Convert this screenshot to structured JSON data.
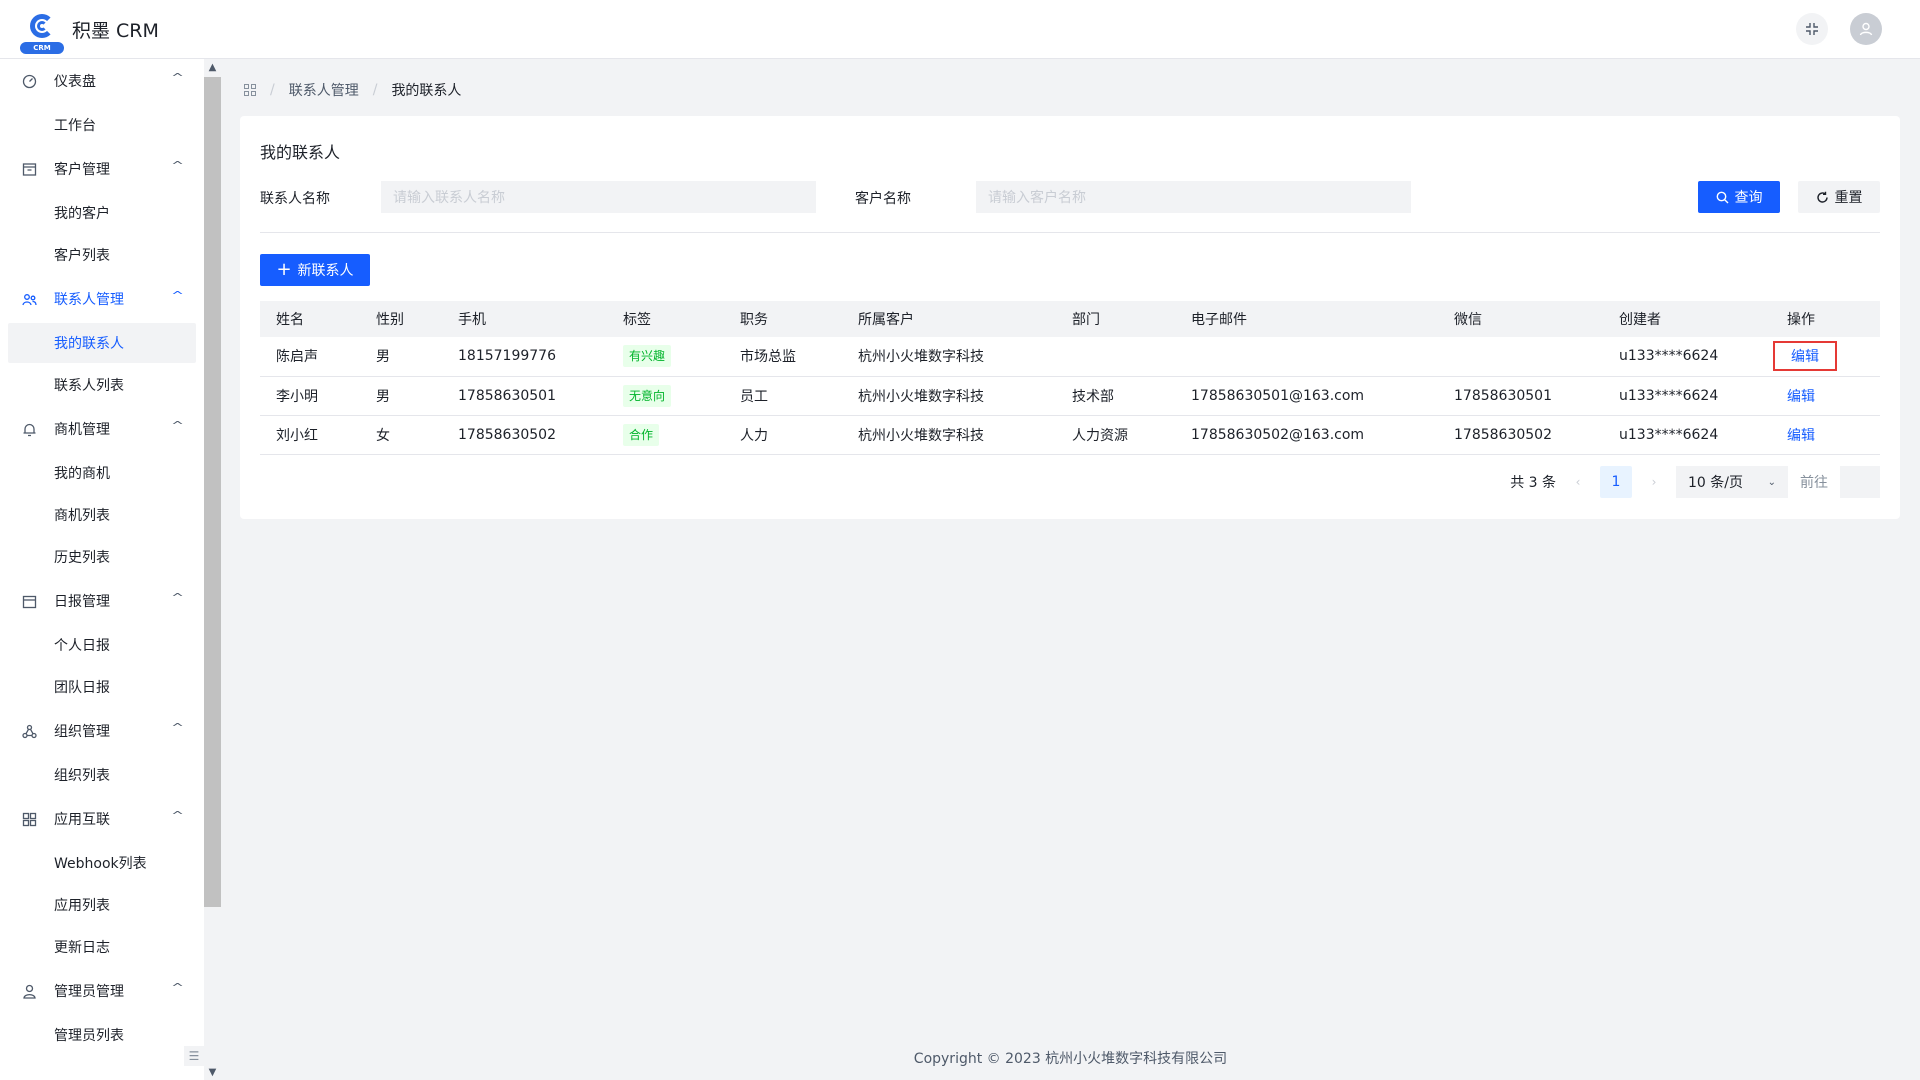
{
  "app": {
    "title": "积墨 CRM",
    "logo_tag": "CRM"
  },
  "sidebar": {
    "groups": [
      {
        "label": "仪表盘",
        "icon": "dashboard-icon",
        "items": [
          "工作台"
        ]
      },
      {
        "label": "客户管理",
        "icon": "customer-icon",
        "items": [
          "我的客户",
          "客户列表"
        ]
      },
      {
        "label": "联系人管理",
        "icon": "contacts-icon",
        "items": [
          "我的联系人",
          "联系人列表"
        ]
      },
      {
        "label": "商机管理",
        "icon": "bell-icon",
        "items": [
          "我的商机",
          "商机列表",
          "历史列表"
        ]
      },
      {
        "label": "日报管理",
        "icon": "calendar-icon",
        "items": [
          "个人日报",
          "团队日报"
        ]
      },
      {
        "label": "组织管理",
        "icon": "org-icon",
        "items": [
          "组织列表"
        ]
      },
      {
        "label": "应用互联",
        "icon": "apps-icon",
        "items": [
          "Webhook列表",
          "应用列表",
          "更新日志"
        ]
      },
      {
        "label": "管理员管理",
        "icon": "user-icon",
        "items": [
          "管理员列表"
        ]
      }
    ],
    "active_item": "我的联系人"
  },
  "breadcrumb": {
    "items": [
      "联系人管理",
      "我的联系人"
    ]
  },
  "card": {
    "title": "我的联系人",
    "filters": {
      "contact_label": "联系人名称",
      "contact_placeholder": "请输入联系人名称",
      "customer_label": "客户名称",
      "customer_placeholder": "请输入客户名称"
    },
    "query_label": "查询",
    "reset_label": "重置",
    "new_label": "新联系人"
  },
  "table": {
    "headers": [
      "姓名",
      "性别",
      "手机",
      "标签",
      "职务",
      "所属客户",
      "部门",
      "电子邮件",
      "微信",
      "创建者",
      "操作"
    ],
    "rows": [
      {
        "name": "陈启声",
        "gender": "男",
        "phone": "18157199776",
        "tag": "有兴趣",
        "title": "市场总监",
        "customer": "杭州小火堆数字科技",
        "dept": "",
        "email": "",
        "wechat": "",
        "creator": "u133****6624",
        "action": "编辑"
      },
      {
        "name": "李小明",
        "gender": "男",
        "phone": "17858630501",
        "tag": "无意向",
        "title": "员工",
        "customer": "杭州小火堆数字科技",
        "dept": "技术部",
        "email": "17858630501@163.com",
        "wechat": "17858630501",
        "creator": "u133****6624",
        "action": "编辑"
      },
      {
        "name": "刘小红",
        "gender": "女",
        "phone": "17858630502",
        "tag": "合作",
        "title": "人力",
        "customer": "杭州小火堆数字科技",
        "dept": "人力资源",
        "email": "17858630502@163.com",
        "wechat": "17858630502",
        "creator": "u133****6624",
        "action": "编辑"
      }
    ]
  },
  "pagination": {
    "total": "共 3 条",
    "current": "1",
    "page_size": "10 条/页",
    "goto_label": "前往"
  },
  "footer": {
    "copyright": "Copyright © 2023 杭州小火堆数字科技有限公司"
  },
  "colors": {
    "primary": "#165dff",
    "tag_green": "#00b42a",
    "highlight_red": "#e53935"
  }
}
